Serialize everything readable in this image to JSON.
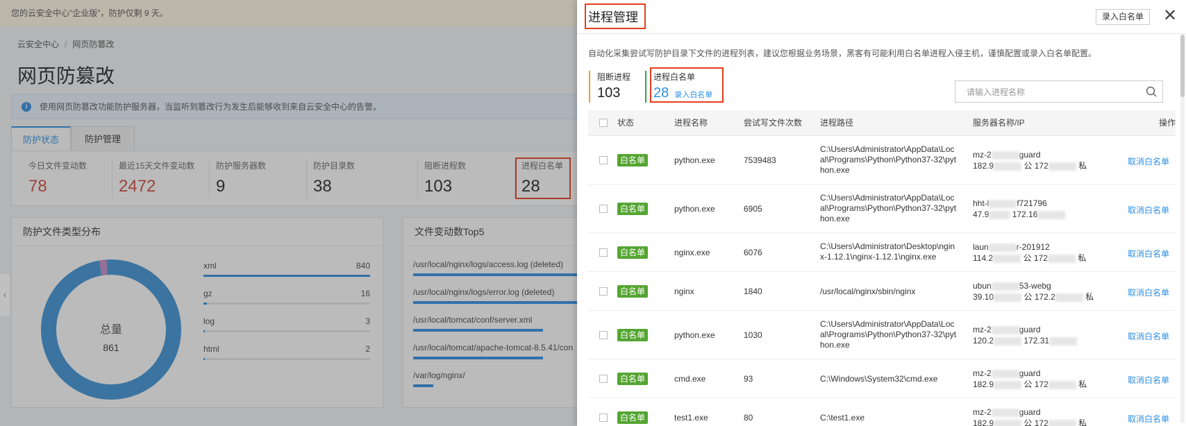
{
  "background": {
    "notice": "您的云安全中心\"企业版\"，防护仅剩 9 天。",
    "breadcrumb": [
      "云安全中心",
      "网页防篡改"
    ],
    "page_title": "网页防篡改",
    "info": "使用网页防篡改功能防护服务器，当监听到篡改行为发生后能够收到来自云安全中心的告警。",
    "tabs": [
      "防护状态",
      "防护管理"
    ],
    "stats": [
      {
        "label": "今日文件变动数",
        "value": "78"
      },
      {
        "label": "最近15天文件变动数",
        "value": "2472"
      },
      {
        "label": "防护服务器数",
        "value": "9"
      },
      {
        "label": "防护目录数",
        "value": "38"
      },
      {
        "label": "阻断进程数",
        "value": "103"
      },
      {
        "label": "进程白名单",
        "value": "28"
      }
    ],
    "file_types_card": {
      "title": "防护文件类型分布",
      "total_label": "总量",
      "total_value": "861",
      "items": [
        {
          "name": "xml",
          "count": 840,
          "count_text": "840"
        },
        {
          "name": "gz",
          "count": 16,
          "count_text": "16"
        },
        {
          "name": "log",
          "count": 3,
          "count_text": "3"
        },
        {
          "name": "html",
          "count": 2,
          "count_text": "2"
        }
      ]
    },
    "top5_card": {
      "title": "文件变动数Top5",
      "items": [
        {
          "path": "/usr/local/nginx/logs/access.log (deleted)",
          "ratio": 1.0
        },
        {
          "path": "/usr/local/nginx/logs/error.log (deleted)",
          "ratio": 1.0
        },
        {
          "path": "/usr/local/tomcat/conf/server.xml",
          "ratio": 0.78
        },
        {
          "path": "/usr/local/tomcat/apache-tomcat-8.5.41/con",
          "ratio": 0.78
        },
        {
          "path": "/var/log/nginx/",
          "ratio": 0.12
        }
      ]
    }
  },
  "drawer": {
    "title": "进程管理",
    "add_whitelist_button": "录入白名单",
    "close_icon": "close-icon",
    "description": "自动化采集尝试写防护目录下文件的进程列表，建议您根据业务场景，黑客有可能利用白名单进程入侵主机，谨慎配置或录入白名单配置。",
    "blocked": {
      "label": "阻断进程",
      "value": "103"
    },
    "whitelist": {
      "label": "进程白名单",
      "value": "28",
      "link": "录入白名单"
    },
    "search_placeholder": "请输入进程名称",
    "columns": [
      "状态",
      "进程名称",
      "尝试写文件次数",
      "进程路径",
      "服务器名称/IP",
      "操作"
    ],
    "rows": [
      {
        "status": "白名单",
        "name": "python.exe",
        "count": "7539483",
        "path": "C:\\Users\\Administrator\\AppData\\Local\\Programs\\Python\\Python37-32\\python.exe",
        "server_prefix": "mz-2",
        "server_suffix": "guard",
        "ip_pub": "182.9",
        "ip_priv": "172",
        "action": "取消白名单"
      },
      {
        "status": "白名单",
        "name": "python.exe",
        "count": "6905",
        "path": "C:\\Users\\Administrator\\AppData\\Local\\Programs\\Python\\Python37-32\\python.exe",
        "server_prefix": "hht-l",
        "server_suffix": "f721796",
        "ip_pub": "47.9",
        "ip_priv": "172.16",
        "action": "取消白名单"
      },
      {
        "status": "白名单",
        "name": "nginx.exe",
        "count": "6076",
        "path": "C:\\Users\\Administrator\\Desktop\\nginx-1.12.1\\nginx-1.12.1\\nginx.exe",
        "server_prefix": "laun",
        "server_suffix": "r-201912",
        "ip_pub": "114.2",
        "ip_priv": "172",
        "action": "取消白名单"
      },
      {
        "status": "白名单",
        "name": "nginx",
        "count": "1840",
        "path": "/usr/local/nginx/sbin/nginx",
        "server_prefix": "ubun",
        "server_suffix": "53-webg",
        "ip_pub": "39.10",
        "ip_priv": "172.2",
        "action": "取消白名单"
      },
      {
        "status": "白名单",
        "name": "python.exe",
        "count": "1030",
        "path": "C:\\Users\\Administrator\\AppData\\Local\\Programs\\Python\\Python37-32\\python.exe",
        "server_prefix": "mz-2",
        "server_suffix": "guard",
        "ip_pub": "120.2",
        "ip_priv": "172.31",
        "action": "取消白名单"
      },
      {
        "status": "白名单",
        "name": "cmd.exe",
        "count": "93",
        "path": "C:\\Windows\\System32\\cmd.exe",
        "server_prefix": "mz-2",
        "server_suffix": "guard",
        "ip_pub": "182.9",
        "ip_priv": "172",
        "action": "取消白名单"
      },
      {
        "status": "白名单",
        "name": "test1.exe",
        "count": "80",
        "path": "C:\\test1.exe",
        "server_prefix": "mz-2",
        "server_suffix": "guard",
        "ip_pub": "182.9",
        "ip_priv": "172",
        "action": "取消白名单"
      }
    ],
    "public_tag": "公",
    "private_tag": "私"
  }
}
